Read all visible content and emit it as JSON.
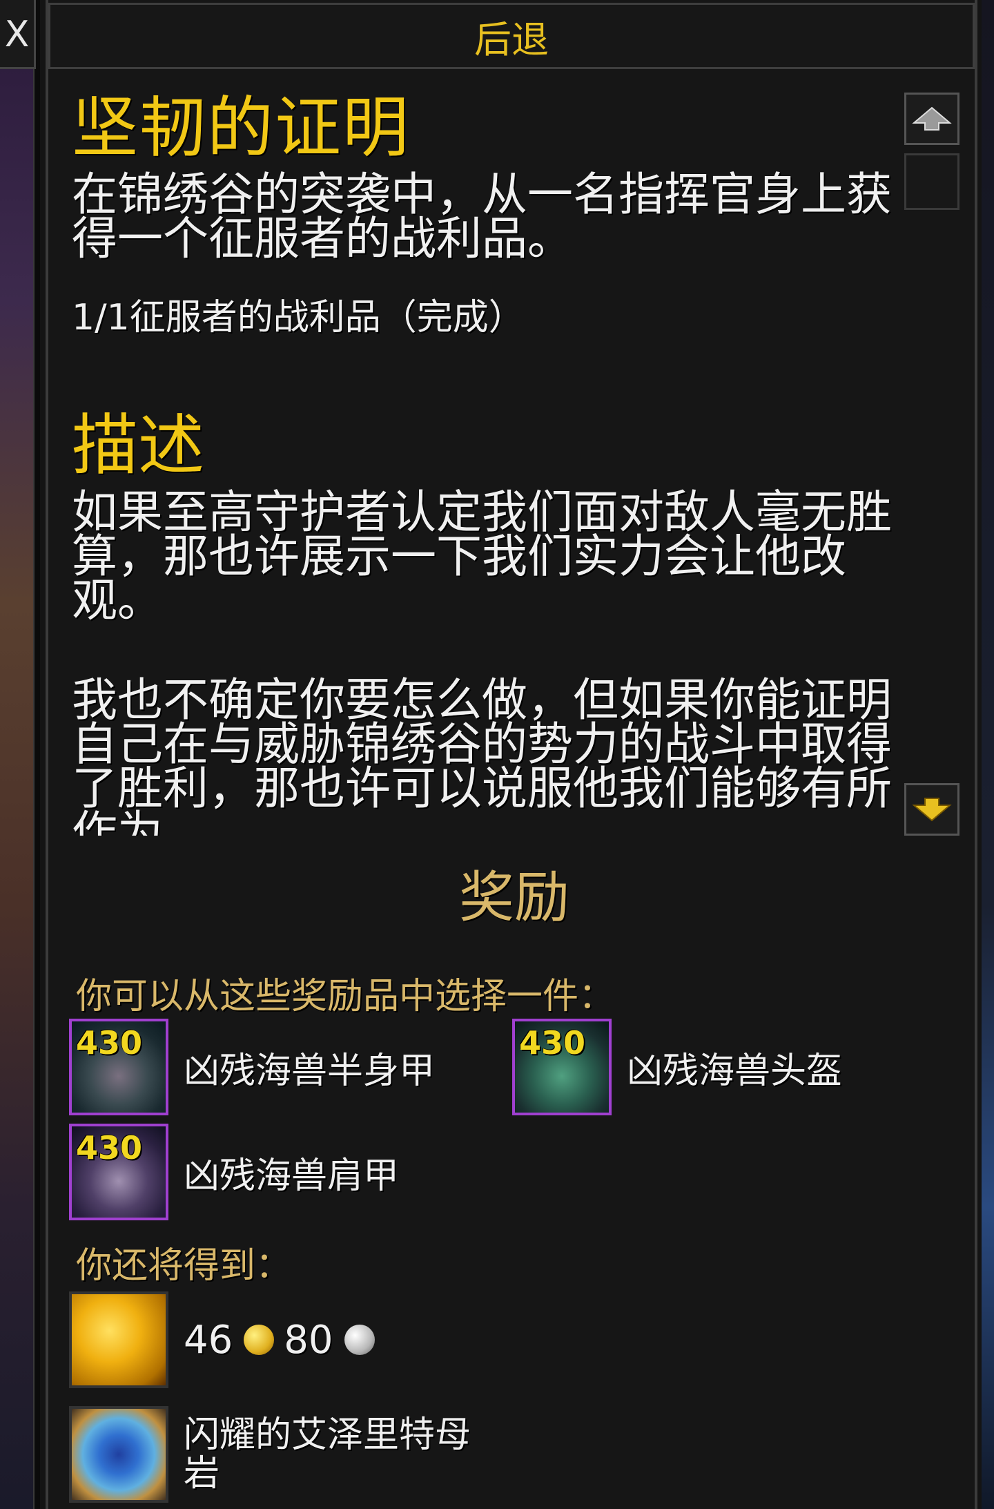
{
  "window": {
    "close_glyph": "X",
    "back_label": "后退"
  },
  "quest": {
    "title": "坚韧的证明",
    "objective_text": "在锦绣谷的突袭中，从一名指挥官身上获得一个征服者的战利品。",
    "progress": "1/1征服者的战利品（完成）",
    "description_heading": "描述",
    "description_p1": "如果至高守护者认定我们面对敌人毫无胜算，那也许展示一下我们实力会让他改观。",
    "description_p2": "我也不确定你要怎么做，但如果你能证明自己在与威胁锦绣谷的势力的战斗中取得了胜利，那也许可以说服他我们能够有所作为。"
  },
  "scrollbar": {
    "up_icon": "arrow-up-icon",
    "down_icon": "arrow-down-icon"
  },
  "rewards": {
    "heading": "奖励",
    "choose_label": "你可以从这些奖励品中选择一件：",
    "choices": [
      {
        "ilvl": "430",
        "name": "凶残海兽半身甲",
        "icon": "chest-armor-icon"
      },
      {
        "ilvl": "430",
        "name": "凶残海兽头盔",
        "icon": "helm-icon"
      },
      {
        "ilvl": "430",
        "name": "凶残海兽肩甲",
        "icon": "shoulder-armor-icon"
      }
    ],
    "also_label": "你还将得到：",
    "money": {
      "gold": "46",
      "silver": "80"
    },
    "extra_item": {
      "name": "闪耀的艾泽里特母岩",
      "icon": "azerite-gem-icon"
    }
  },
  "colors": {
    "title_gold": "#f2c815",
    "reward_tan": "#d9b86a",
    "epic_border": "#a040d0",
    "panel_bg": "#161616"
  }
}
